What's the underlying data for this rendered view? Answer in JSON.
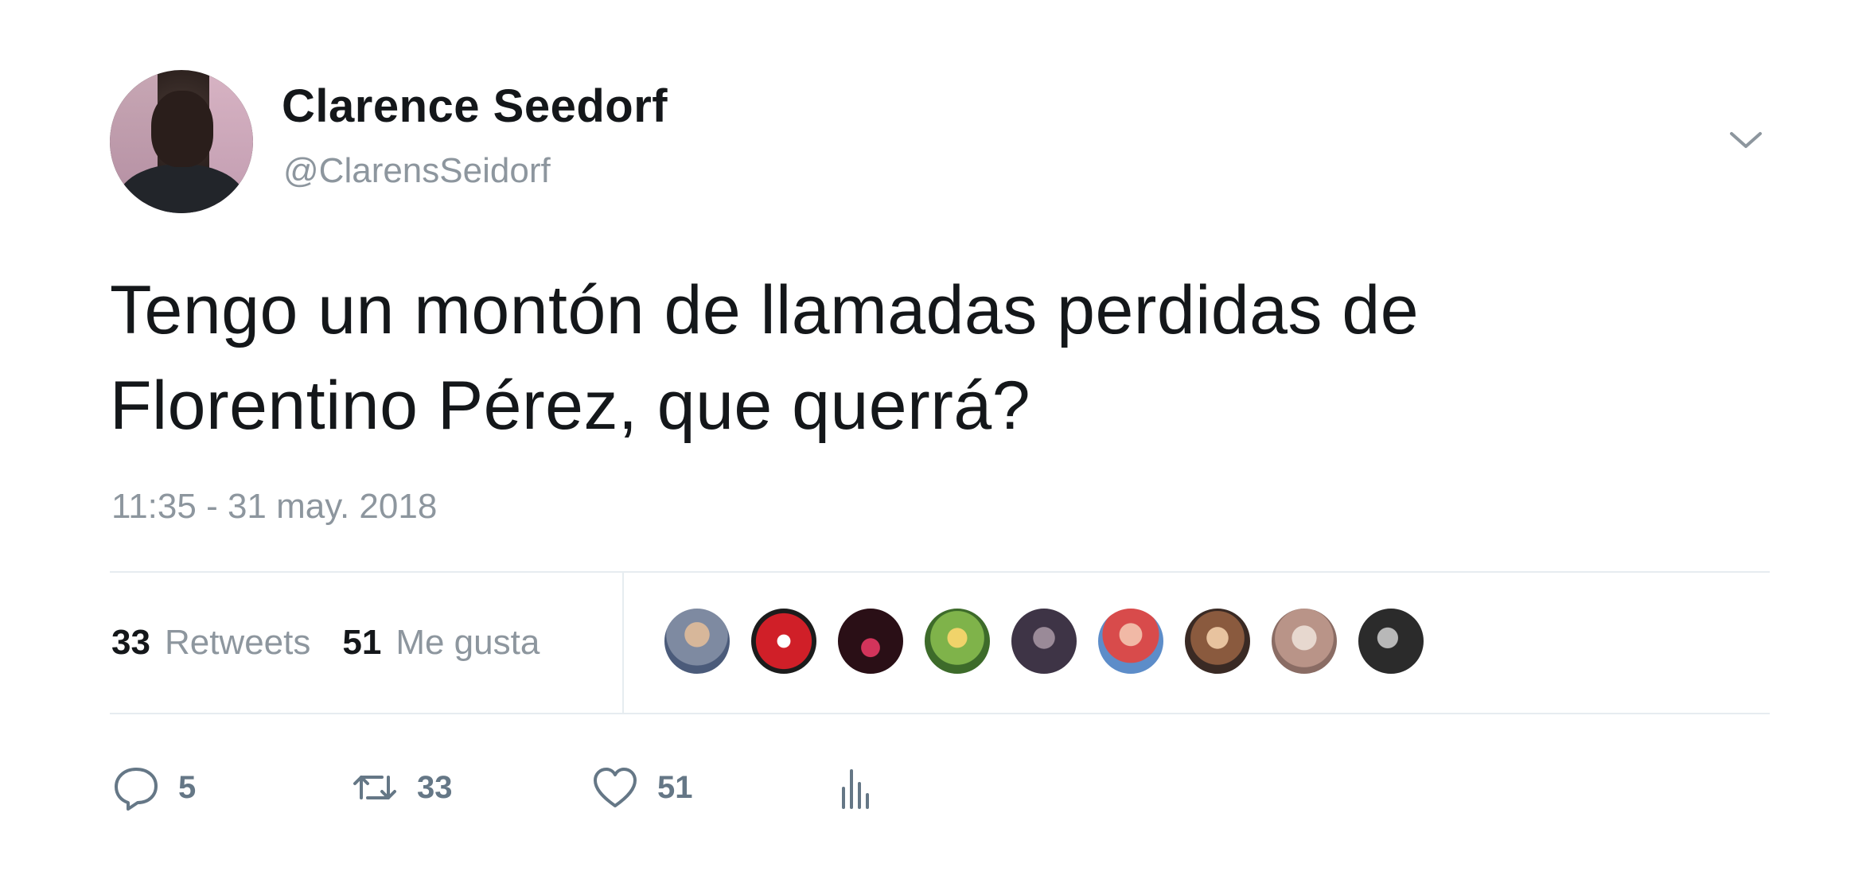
{
  "user": {
    "display_name": "Clarence Seedorf",
    "screen_name": "@ClarensSeidorf"
  },
  "tweet": {
    "lines": [
      "Tengo un montón de llamadas perdidas de",
      "Florentino Pérez, que querrá?"
    ],
    "timestamp": "11:35 - 31 may. 2018"
  },
  "stats": {
    "retweets_count": "33",
    "retweets_label": "Retweets",
    "likes_count": "51",
    "likes_label": "Me gusta"
  },
  "likers_count": 9,
  "actions": {
    "reply_count": "5",
    "retweet_count": "33",
    "like_count": "51"
  },
  "colors": {
    "text": "#14171a",
    "secondary": "#8d969e",
    "icon": "#657786",
    "divider": "#e6ecf0"
  },
  "icons": [
    "chevron-down-icon",
    "reply-icon",
    "retweet-icon",
    "heart-icon",
    "analytics-icon"
  ]
}
